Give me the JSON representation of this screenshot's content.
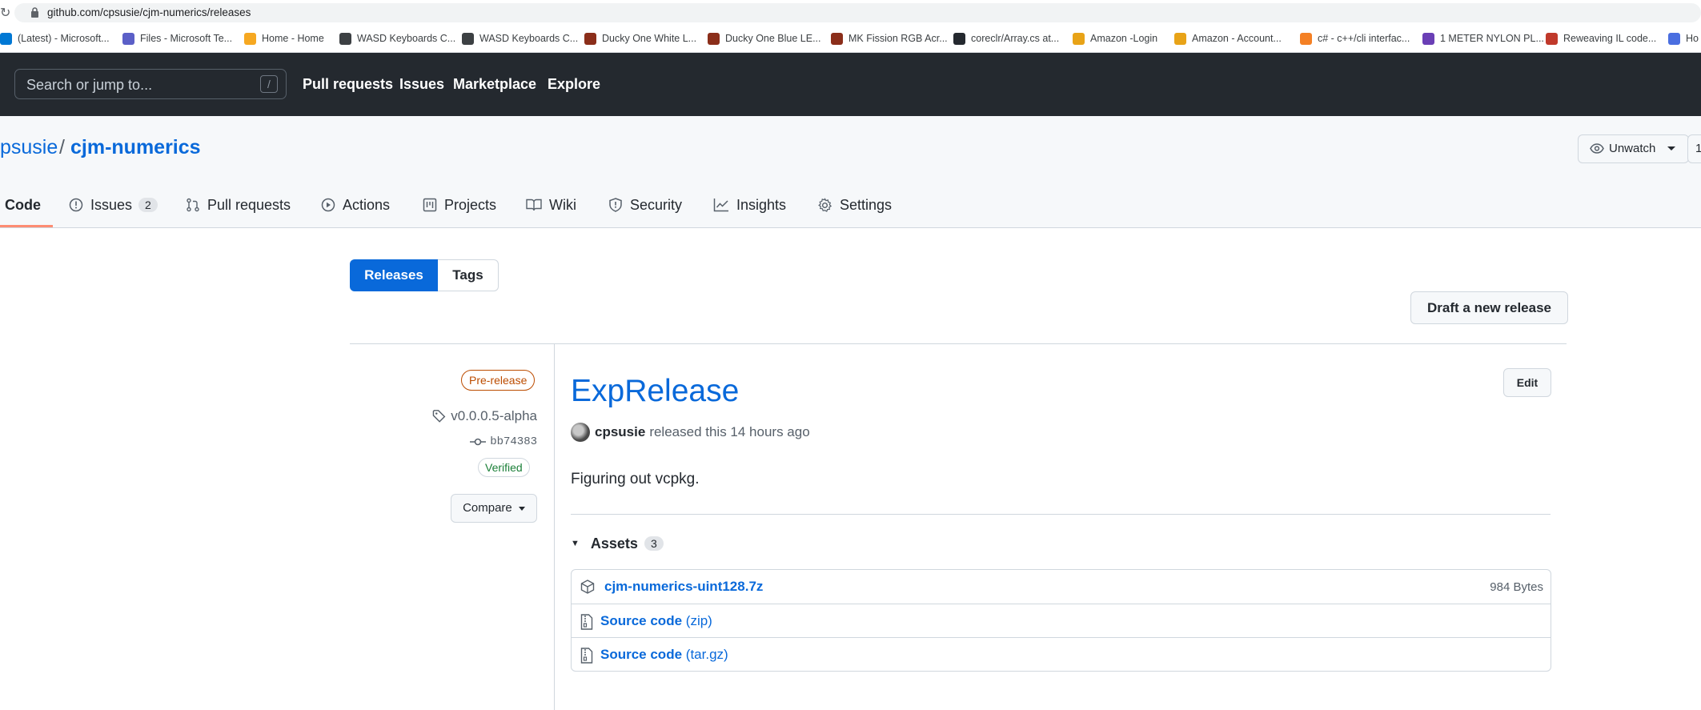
{
  "browser": {
    "url": "github.com/cpsusie/cjm-numerics/releases",
    "bookmarks": [
      {
        "label": "(Latest) - Microsoft...",
        "icon": "microsoft-icon"
      },
      {
        "label": "Files - Microsoft Te...",
        "icon": "teams-icon"
      },
      {
        "label": "Home - Home",
        "icon": "home-icon"
      },
      {
        "label": "WASD Keyboards C...",
        "icon": "keyboard-icon"
      },
      {
        "label": "WASD Keyboards C...",
        "icon": "keyboard-icon"
      },
      {
        "label": "Ducky One White L...",
        "icon": "ducky-icon"
      },
      {
        "label": "Ducky One Blue LE...",
        "icon": "ducky-icon"
      },
      {
        "label": "MK Fission RGB Acr...",
        "icon": "ducky-icon"
      },
      {
        "label": "coreclr/Array.cs at...",
        "icon": "github-icon"
      },
      {
        "label": "Amazon -Login",
        "icon": "amazon-icon"
      },
      {
        "label": "Amazon - Account...",
        "icon": "amazon-icon"
      },
      {
        "label": "c# - c++/cli interfac...",
        "icon": "stackoverflow-icon"
      },
      {
        "label": "1 METER NYLON PL...",
        "icon": "product-icon"
      },
      {
        "label": "Reweaving IL code...",
        "icon": "blog-icon"
      },
      {
        "label": "Ho",
        "icon": "bookmark-icon"
      }
    ]
  },
  "header": {
    "search_placeholder": "Search or jump to...",
    "search_shortcut": "/",
    "nav": [
      "Pull requests",
      "Issues",
      "Marketplace",
      "Explore"
    ]
  },
  "repo": {
    "owner": "psusie",
    "separator": "/",
    "name": "cjm-numerics",
    "unwatch_label": "Unwatch",
    "star_count_partial": "1",
    "tabs": [
      {
        "label": "Code",
        "icon": "code-icon"
      },
      {
        "label": "Issues",
        "icon": "issue-icon",
        "counter": "2"
      },
      {
        "label": "Pull requests",
        "icon": "pull-request-icon"
      },
      {
        "label": "Actions",
        "icon": "play-icon"
      },
      {
        "label": "Projects",
        "icon": "project-icon"
      },
      {
        "label": "Wiki",
        "icon": "book-icon"
      },
      {
        "label": "Security",
        "icon": "shield-icon"
      },
      {
        "label": "Insights",
        "icon": "graph-icon"
      },
      {
        "label": "Settings",
        "icon": "gear-icon"
      }
    ]
  },
  "releases_page": {
    "seg_releases": "Releases",
    "seg_tags": "Tags",
    "draft_button": "Draft a new release"
  },
  "release": {
    "badge": "Pre-release",
    "tag": "v0.0.0.5-alpha",
    "commit": "bb74383",
    "verified": "Verified",
    "compare": "Compare",
    "title": "ExpRelease",
    "edit": "Edit",
    "author": "cpsusie",
    "released_text": "released this 14 hours ago",
    "body": "Figuring out vcpkg.",
    "assets_label": "Assets",
    "assets_count": "3",
    "assets": [
      {
        "name": "cjm-numerics-uint128.7z",
        "size": "984 Bytes",
        "icon": "package-icon"
      },
      {
        "name": "Source code",
        "suffix": "(zip)",
        "icon": "file-zip-icon"
      },
      {
        "name": "Source code",
        "suffix": "(tar.gz)",
        "icon": "file-zip-icon"
      }
    ]
  }
}
